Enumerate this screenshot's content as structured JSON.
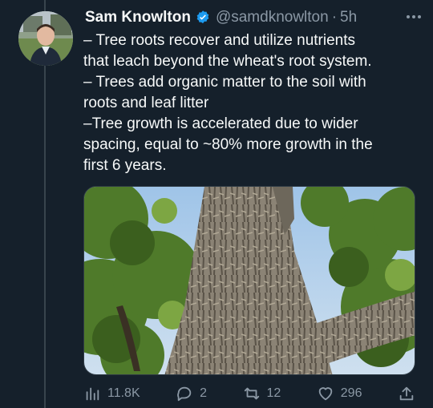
{
  "tweet": {
    "author": {
      "display_name": "Sam Knowlton",
      "handle": "@samdknowlton",
      "verified": true,
      "verified_color": "#1d9bf0"
    },
    "separator": "·",
    "time": "5h",
    "more_icon": "more-dots-icon",
    "text_lines": [
      "– Tree roots recover and utilize nutrients",
      "that leach beyond the wheat's root system.",
      "– Trees add organic matter to the soil with",
      "roots and leaf litter",
      "–Tree growth is accelerated due to wider",
      "spacing, equal to ~80% more growth in the",
      "first 6 years."
    ],
    "stats": {
      "views": "11.8K",
      "replies": "2",
      "retweets": "12",
      "likes": "296"
    }
  },
  "colors": {
    "background": "#15202b",
    "text_primary": "#f7f9f9",
    "text_secondary": "#8b98a5",
    "accent": "#1d9bf0"
  }
}
